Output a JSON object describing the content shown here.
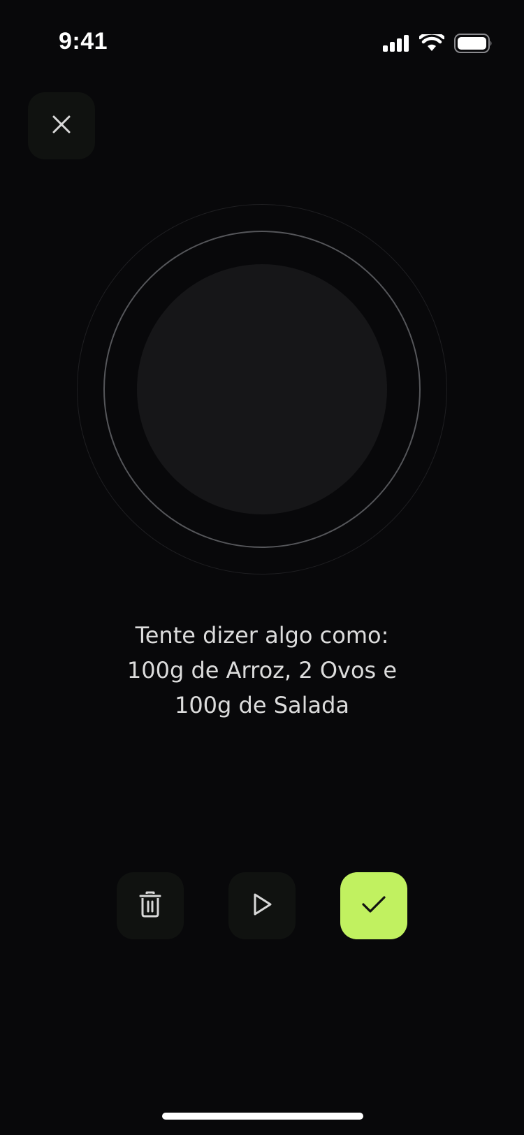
{
  "status_bar": {
    "time": "9:41",
    "icons": [
      "cellular-signal-icon",
      "wifi-icon",
      "battery-icon"
    ]
  },
  "header": {
    "close_icon": "close-icon"
  },
  "hint": {
    "line1": "Tente dizer algo como:",
    "line2": "100g de Arroz, 2 Ovos e",
    "line3": "100g de Salada"
  },
  "actions": {
    "delete_icon": "trash-icon",
    "play_icon": "play-icon",
    "confirm_icon": "check-icon"
  },
  "colors": {
    "background": "#08080a",
    "button_bg": "#101210",
    "accent": "#c1f160",
    "ring": "#55565a",
    "core": "#161618"
  }
}
